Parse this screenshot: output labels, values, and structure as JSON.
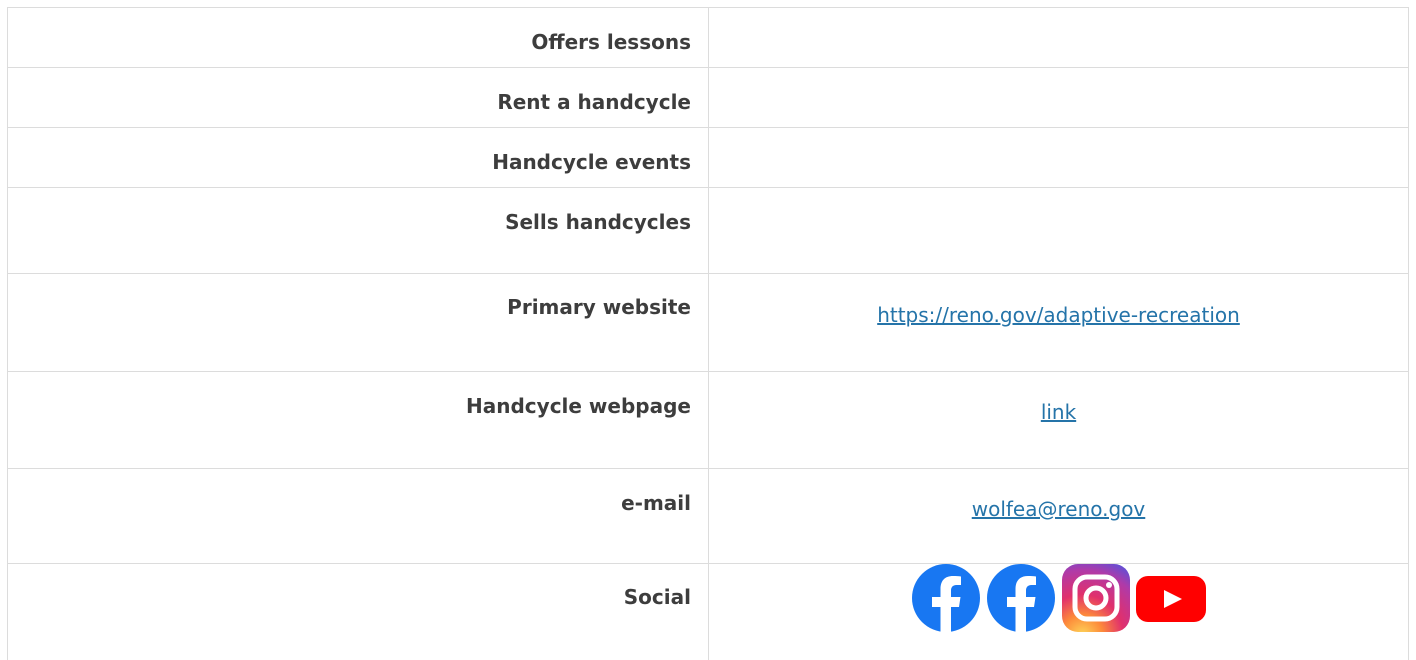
{
  "rows": [
    {
      "label": "Offers lessons",
      "value": ""
    },
    {
      "label": "Rent a handcycle",
      "value": ""
    },
    {
      "label": "Handcycle events",
      "value": ""
    },
    {
      "label": "Sells handcycles",
      "value": ""
    },
    {
      "label": "Primary website",
      "value": "https://reno.gov/adaptive-recreation"
    },
    {
      "label": "Handcycle webpage",
      "value": "link"
    },
    {
      "label": "e-mail",
      "value": "wolfea@reno.gov"
    },
    {
      "label": "Social",
      "value": ""
    }
  ],
  "social_icons": [
    "facebook-icon",
    "facebook-icon",
    "instagram-icon",
    "youtube-icon"
  ],
  "colors": {
    "label_text": "#3d3d3d",
    "link": "#2574a9",
    "border": "#dcdcdc",
    "facebook": "#1877f2",
    "youtube": "#ff0000"
  }
}
